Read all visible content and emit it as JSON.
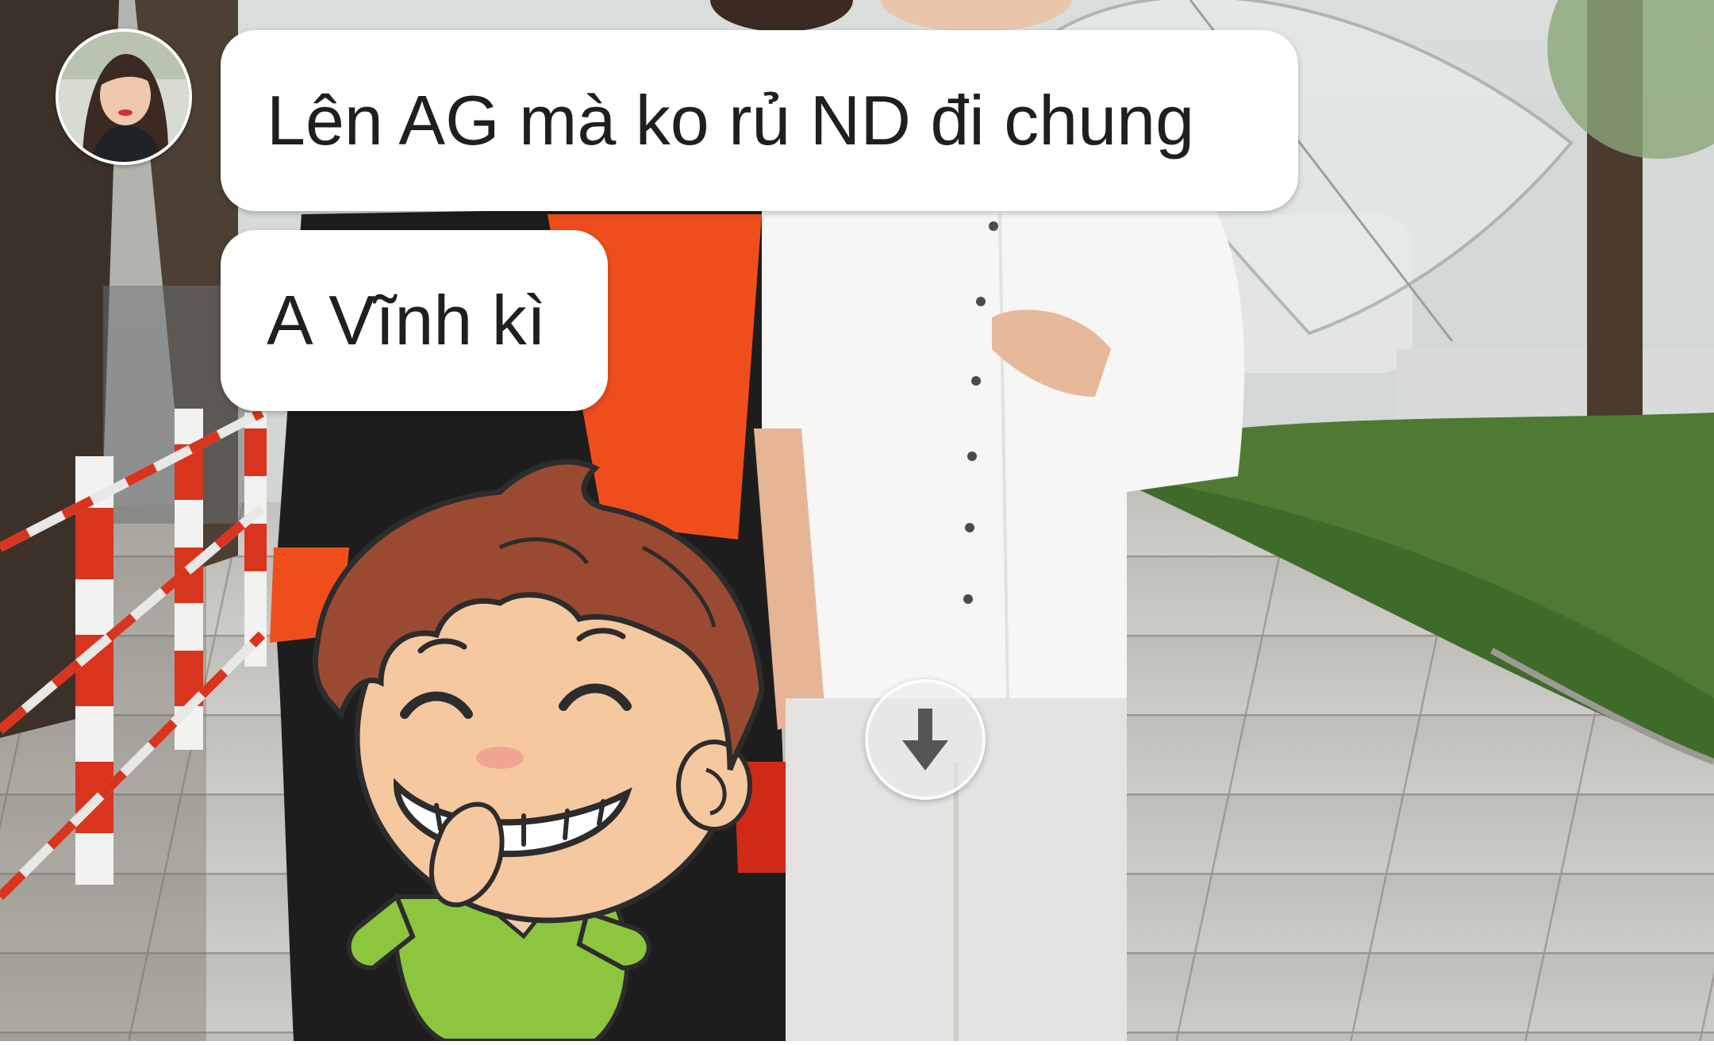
{
  "chat": {
    "messages": [
      {
        "text": "Lên AG mà ko rủ ND đi chung"
      },
      {
        "text": "A Vĩnh kì"
      }
    ],
    "avatar_icon": "user-avatar",
    "sticker_icon": "grinning-boy-sticker",
    "scroll_icon": "arrow-down-icon"
  },
  "colors": {
    "bubble": "#ffffff",
    "text": "#1f1f1f",
    "pavement": "#c8c7c4",
    "grass": "#4e7a34",
    "shirt": "#f6f6f4",
    "robe": "#1d1d1d",
    "sash": "#ef4e1c"
  }
}
